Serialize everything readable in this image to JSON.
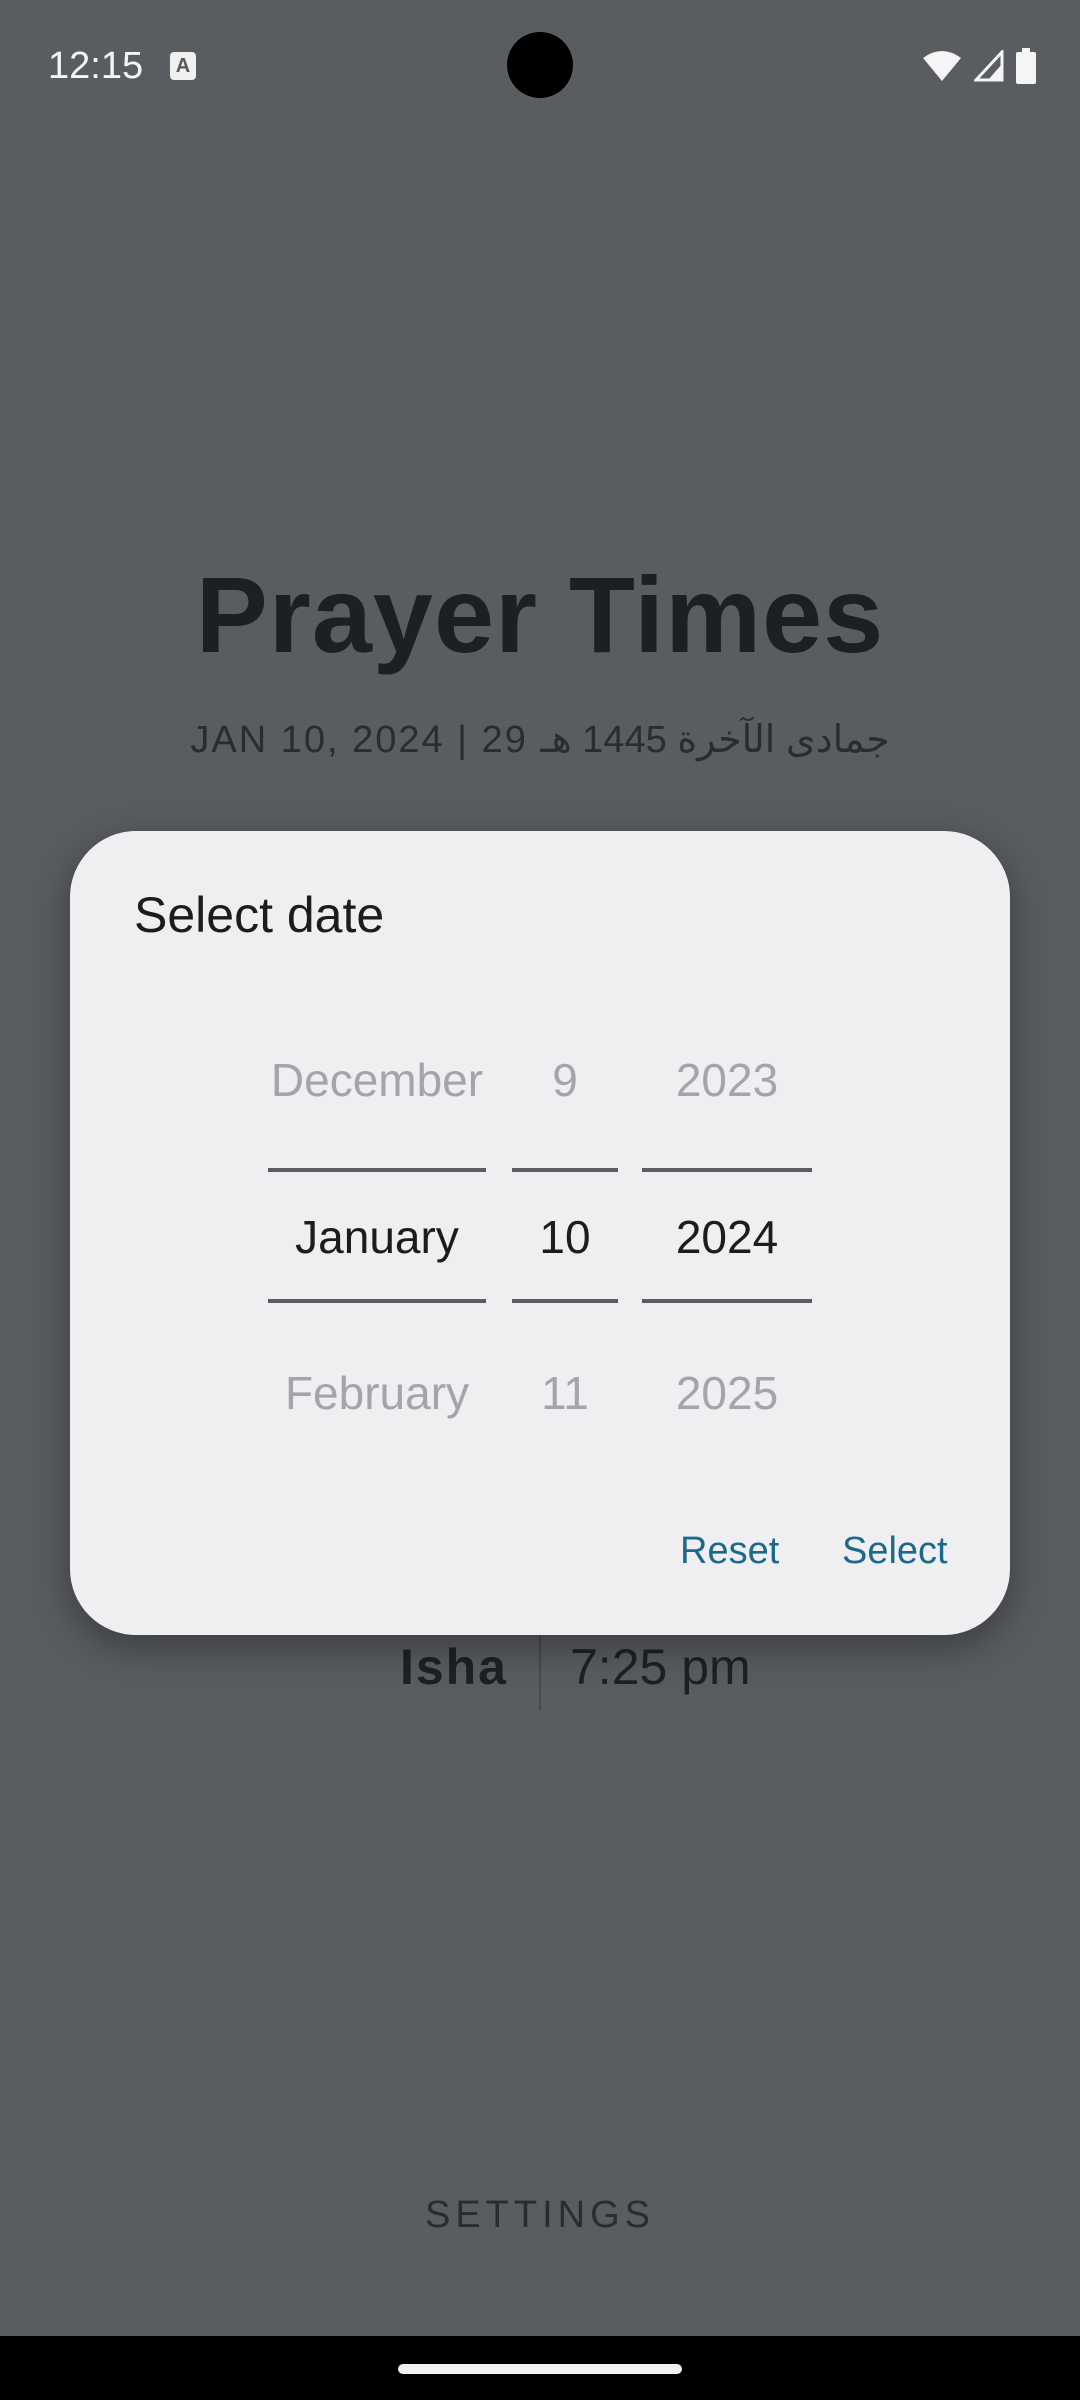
{
  "status_bar": {
    "time": "12:15",
    "notification_icon": "A",
    "icons": [
      "wifi-icon",
      "cell-signal-icon",
      "battery-icon"
    ]
  },
  "app": {
    "title": "Prayer Times",
    "date_line": "JAN 10, 2024  |  29 جمادى الآخرة 1445 هـ",
    "isha_label": "Isha",
    "isha_time": "7:25 pm",
    "settings_label": "SETTINGS"
  },
  "dialog": {
    "title": "Select date",
    "month": {
      "prev": "December",
      "selected": "January",
      "next": "February"
    },
    "day": {
      "prev": "9",
      "selected": "10",
      "next": "11"
    },
    "year": {
      "prev": "2023",
      "selected": "2024",
      "next": "2025"
    },
    "reset_label": "Reset",
    "select_label": "Select"
  },
  "colors": {
    "scrim_background": "#595c60",
    "dialog_background": "#efeff1",
    "accent": "#1b6a8c"
  }
}
